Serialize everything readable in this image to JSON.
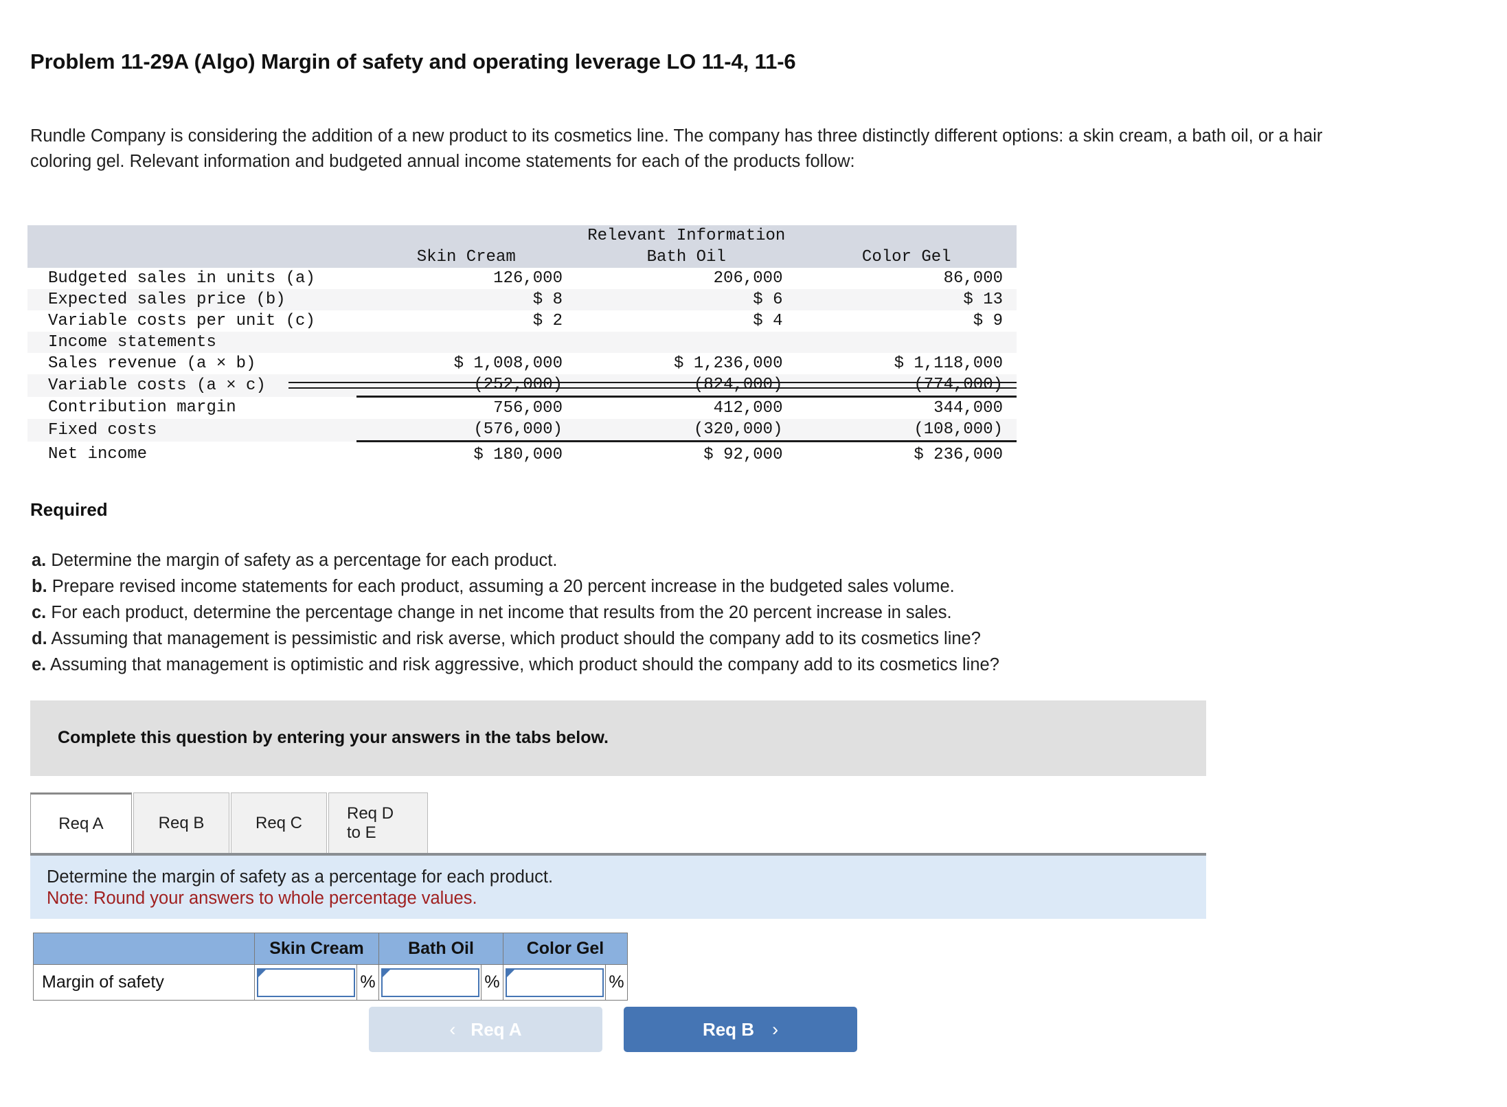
{
  "problem": {
    "title": "Problem 11-29A (Algo) Margin of safety and operating leverage LO 11-4, 11-6",
    "intro": "Rundle Company is considering the addition of a new product to its cosmetics line. The company has three distinctly different options: a skin cream, a bath oil, or a hair coloring gel. Relevant information and budgeted annual income statements for each of the products follow:"
  },
  "info_table": {
    "band_title": "Relevant Information",
    "columns": [
      "Skin Cream",
      "Bath Oil",
      "Color Gel"
    ],
    "rows": [
      {
        "label": "Budgeted sales in units (a)",
        "values": [
          "126,000",
          "206,000",
          "86,000"
        ]
      },
      {
        "label": "Expected sales price (b)",
        "values": [
          "$ 8",
          "$ 6",
          "$ 13"
        ]
      },
      {
        "label": "Variable costs per unit (c)",
        "values": [
          "$ 2",
          "$ 4",
          "$ 9"
        ]
      },
      {
        "label": "Income statements",
        "values": [
          "",
          "",
          ""
        ]
      },
      {
        "label": "Sales revenue (a × b)",
        "values": [
          "$ 1,008,000",
          "$ 1,236,000",
          "$ 1,118,000"
        ]
      },
      {
        "label": "Variable costs (a × c)",
        "values": [
          "(252,000)",
          "(824,000)",
          "(774,000)"
        ]
      },
      {
        "label": "Contribution margin",
        "values": [
          "756,000",
          "412,000",
          "344,000"
        ]
      },
      {
        "label": "Fixed costs",
        "values": [
          "(576,000)",
          "(320,000)",
          "(108,000)"
        ]
      },
      {
        "label": "Net income",
        "values": [
          "$ 180,000",
          "$ 92,000",
          "$ 236,000"
        ]
      }
    ]
  },
  "required": {
    "heading": "Required",
    "items": [
      {
        "marker": "a.",
        "text": "Determine the margin of safety as a percentage for each product."
      },
      {
        "marker": "b.",
        "text": "Prepare revised income statements for each product, assuming a 20 percent increase in the budgeted sales volume."
      },
      {
        "marker": "c.",
        "text": "For each product, determine the percentage change in net income that results from the 20 percent  increase in sales."
      },
      {
        "marker": "d.",
        "text": "Assuming that management is pessimistic and risk averse, which product should the company add to its cosmetics line?"
      },
      {
        "marker": "e.",
        "text": "Assuming that management is optimistic and risk aggressive, which product should the company add to its cosmetics line?"
      }
    ]
  },
  "instruction_bar": {
    "text": "Complete this question by entering your answers in the tabs below."
  },
  "tabs": [
    {
      "label": "Req A",
      "active": true
    },
    {
      "label": "Req B",
      "active": false
    },
    {
      "label": "Req C",
      "active": false
    },
    {
      "label": "Req D to E",
      "active": false
    }
  ],
  "note_panel": {
    "prompt": "Determine the margin of safety as a percentage for each product.",
    "note": "Note: Round your answers to whole percentage values."
  },
  "answer_table": {
    "blank_header": "",
    "columns": [
      "Skin Cream",
      "Bath Oil",
      "Color Gel"
    ],
    "row_label": "Margin of safety",
    "values": [
      "",
      "",
      ""
    ],
    "unit": "%"
  },
  "navigation": {
    "prev_label": "Req A",
    "prev_chevron": "‹",
    "next_label": "Req B",
    "next_chevron": "›"
  },
  "colors": {
    "accent_blue": "#4575b4",
    "header_blue": "#8ab0de",
    "note_blue": "#dce9f7",
    "band_gray": "#d5d9e2",
    "bar_gray": "#e0e0e0",
    "note_red": "#a02020"
  }
}
